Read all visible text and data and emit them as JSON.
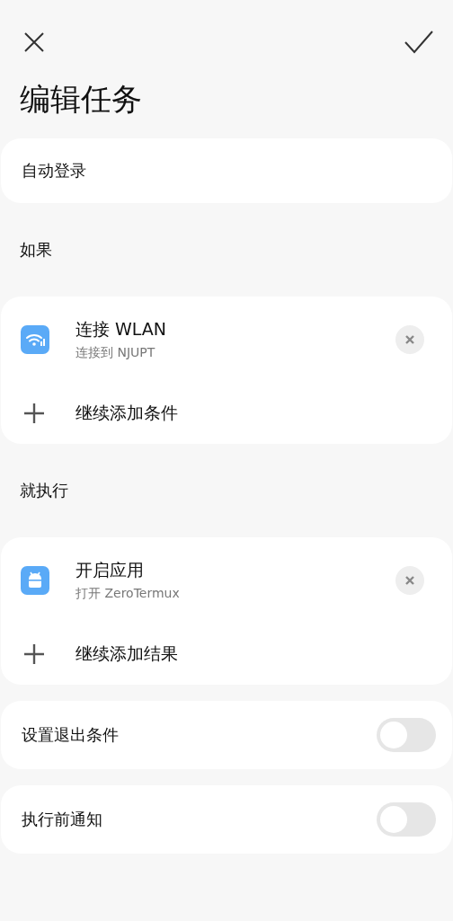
{
  "title": "编辑任务",
  "task_name": "自动登录",
  "sections": [
    {
      "label": "如果",
      "items": [
        {
          "kind": "wifi",
          "title": "连接 WLAN",
          "subtitle": "连接到 NJUPT"
        }
      ],
      "add_label": "继续添加条件"
    },
    {
      "label": "就执行",
      "items": [
        {
          "kind": "app",
          "title": "开启应用",
          "subtitle": "打开 ZeroTermux"
        }
      ],
      "add_label": "继续添加结果"
    }
  ],
  "toggles": [
    {
      "label": "设置退出条件",
      "on": false
    },
    {
      "label": "执行前通知",
      "on": false
    }
  ]
}
